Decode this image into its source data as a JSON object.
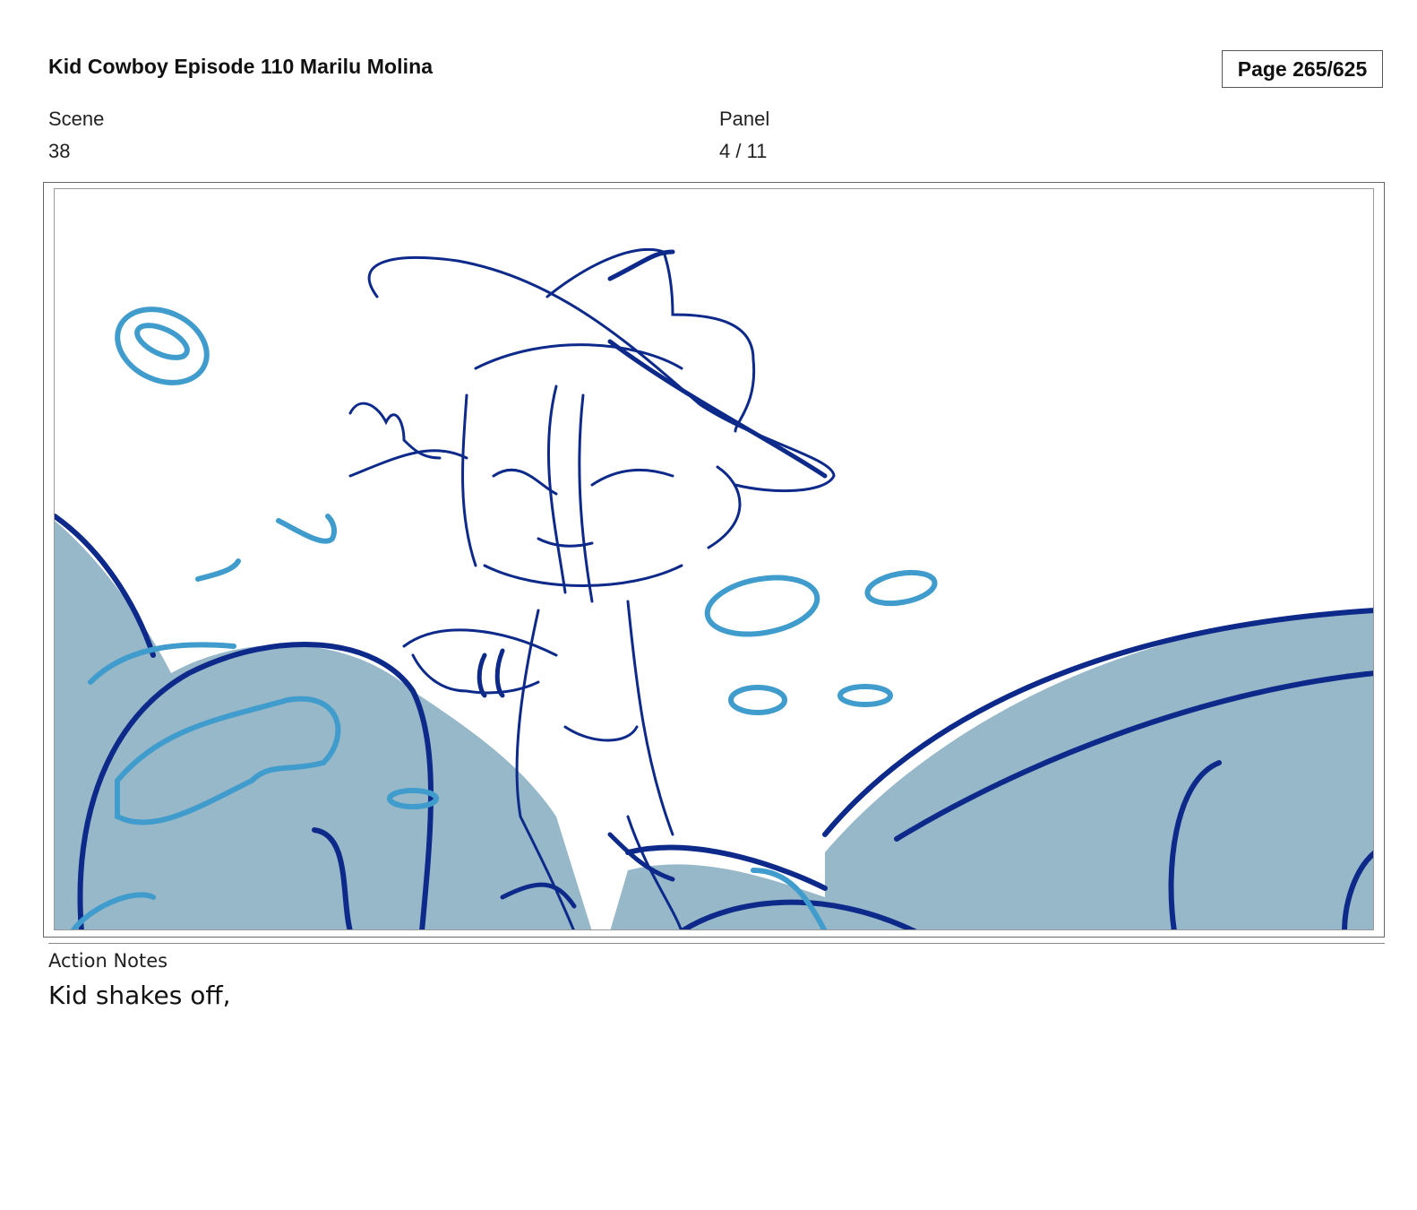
{
  "header": {
    "title": "Kid Cowboy Episode 110 Marilu Molina",
    "page": "Page 265/625"
  },
  "meta": {
    "scene_label": "Scene",
    "scene_value": "38",
    "panel_label": "Panel",
    "panel_value": "4 / 11"
  },
  "notes": {
    "label": "Action Notes",
    "text": "Kid shakes off,"
  },
  "colors": {
    "line_dark": "#0d2a8a",
    "line_light": "#3f9ccc",
    "fill_rock": "#97b8c8"
  }
}
